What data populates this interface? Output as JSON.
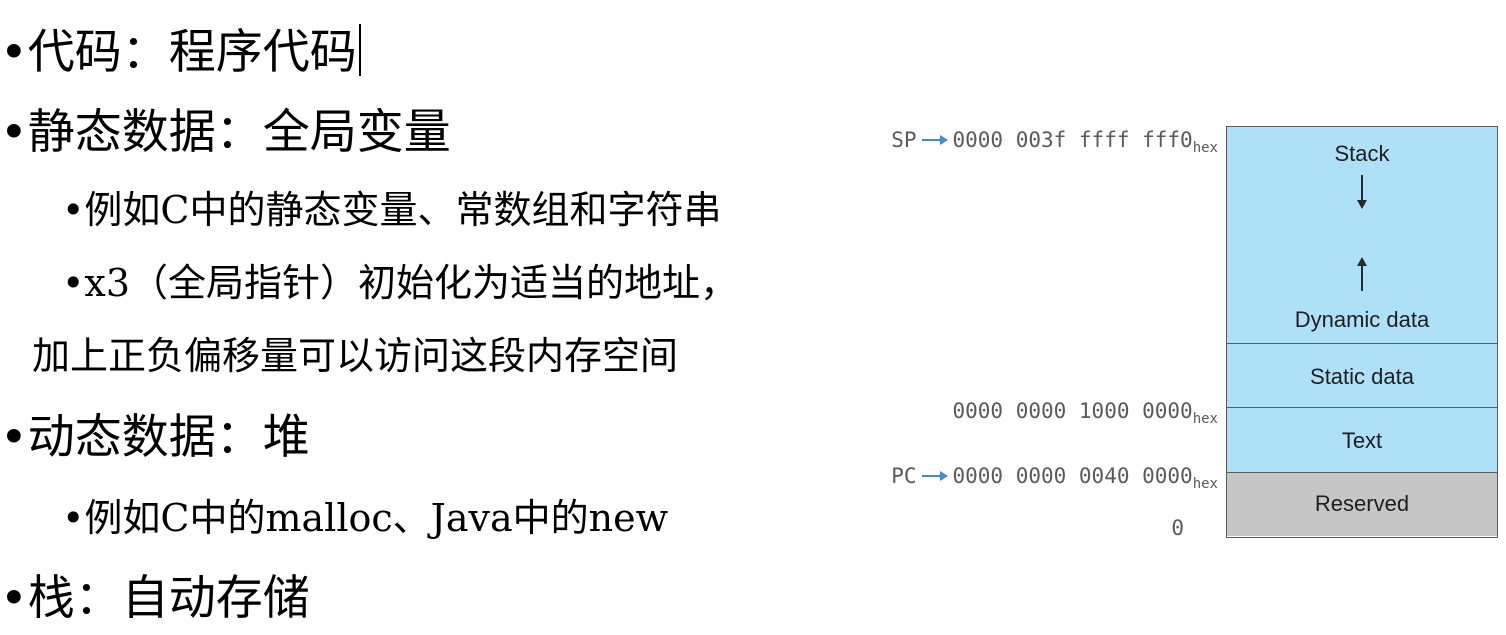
{
  "bullets": [
    {
      "text": "代码：程序代码"
    },
    {
      "text": "静态数据：全局变量"
    },
    {
      "text": "例如C中的静态变量、常数组和字符串"
    },
    {
      "text": "x3（全局指针）初始化为适当的地址，"
    },
    {
      "text": "加上正负偏移量可以访问这段内存空间"
    },
    {
      "text": "动态数据：堆"
    },
    {
      "text": "例如C中的malloc、Java中的new"
    },
    {
      "text": "栈：自动存储"
    }
  ],
  "bullet_glyph": "•",
  "diagram": {
    "segments": {
      "stack": "Stack",
      "dynamic": "Dynamic data",
      "static": "Static data",
      "text": "Text",
      "reserved": "Reserved"
    },
    "addresses": {
      "sp_label": "SP",
      "sp_value": "0000 003f ffff fff0",
      "static_value": "0000 0000 1000 0000",
      "pc_label": "PC",
      "pc_value": "0000 0000 0040 0000",
      "zero": "0",
      "hex_suffix": "hex"
    },
    "colors": {
      "segment_fill": "#aee0f7",
      "reserved_fill": "#c6c6c6",
      "pointer_arrow": "#3a8fd0"
    }
  }
}
